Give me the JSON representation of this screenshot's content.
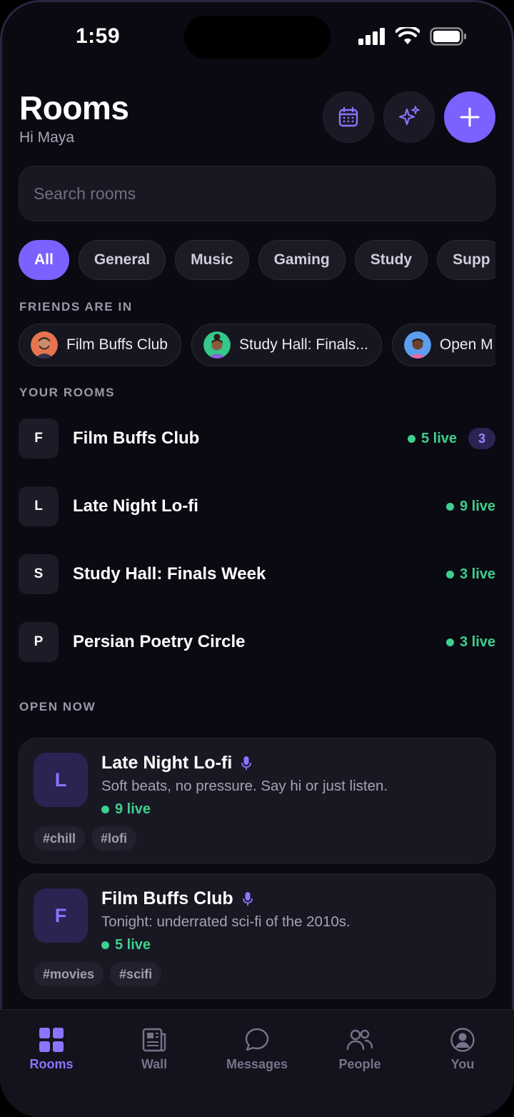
{
  "status_bar": {
    "time": "1:59"
  },
  "header": {
    "title": "Rooms",
    "greeting": "Hi Maya"
  },
  "search": {
    "placeholder": "Search rooms"
  },
  "filters": [
    "All",
    "General",
    "Music",
    "Gaming",
    "Study",
    "Supp"
  ],
  "friends_section": {
    "title": "FRIENDS ARE IN",
    "items": [
      {
        "label": "Film Buffs Club"
      },
      {
        "label": "Study Hall: Finals..."
      },
      {
        "label": "Open M"
      }
    ]
  },
  "your_rooms": {
    "title": "YOUR ROOMS",
    "items": [
      {
        "letter": "F",
        "name": "Film Buffs Club",
        "live": "5 live",
        "badge": "3"
      },
      {
        "letter": "L",
        "name": "Late Night Lo-fi",
        "live": "9 live"
      },
      {
        "letter": "S",
        "name": "Study Hall: Finals Week",
        "live": "3 live"
      },
      {
        "letter": "P",
        "name": "Persian Poetry Circle",
        "live": "3 live"
      }
    ]
  },
  "open_now": {
    "title": "OPEN NOW",
    "cards": [
      {
        "letter": "L",
        "title": "Late Night Lo-fi",
        "description": "Soft beats, no pressure. Say hi or just listen.",
        "live": "9 live",
        "tags": [
          "#chill",
          "#lofi"
        ]
      },
      {
        "letter": "F",
        "title": "Film Buffs Club",
        "description": "Tonight: underrated sci-fi of the 2010s.",
        "live": "5 live",
        "tags": [
          "#movies",
          "#scifi"
        ]
      }
    ]
  },
  "nav": [
    "Rooms",
    "Wall",
    "Messages",
    "People",
    "You"
  ],
  "colors": {
    "accent": "#7b61ff",
    "live": "#3ecf8e",
    "background": "#0a0a12"
  },
  "icons": {
    "header": [
      "calendar-icon",
      "sparkles-icon",
      "plus-icon"
    ],
    "nav": [
      "grid-icon",
      "newspaper-icon",
      "chat-icon",
      "people-icon",
      "profile-icon"
    ]
  }
}
